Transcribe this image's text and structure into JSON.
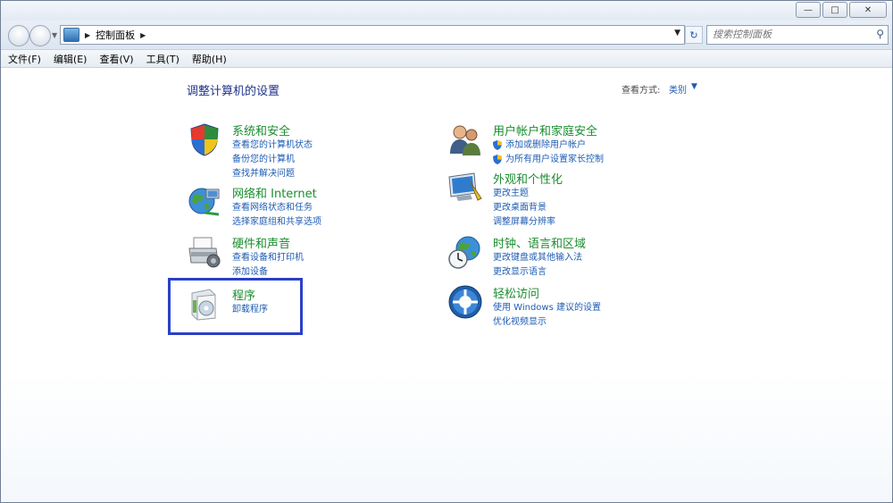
{
  "window": {
    "buttons": {
      "minimize": "—",
      "maximize": "□",
      "close": "✕"
    }
  },
  "address": {
    "crumb": "控制面板"
  },
  "search": {
    "placeholder": "搜索控制面板"
  },
  "menu": [
    "文件(F)",
    "编辑(E)",
    "查看(V)",
    "工具(T)",
    "帮助(H)"
  ],
  "page": {
    "heading": "调整计算机的设置",
    "view_by_label": "查看方式:",
    "view_by_value": "类别"
  },
  "categories": [
    {
      "title": "系统和安全",
      "links": [
        "查看您的计算机状态",
        "备份您的计算机",
        "查找并解决问题"
      ]
    },
    {
      "title": "网络和 Internet",
      "links": [
        "查看网络状态和任务",
        "选择家庭组和共享选项"
      ]
    },
    {
      "title": "硬件和声音",
      "links": [
        "查看设备和打印机",
        "添加设备"
      ]
    },
    {
      "title": "程序",
      "links": [
        "卸载程序"
      ]
    },
    {
      "title": "用户帐户和家庭安全",
      "links": [
        "添加或删除用户帐户",
        "为所有用户设置家长控制"
      ]
    },
    {
      "title": "外观和个性化",
      "links": [
        "更改主题",
        "更改桌面背景",
        "调整屏幕分辨率"
      ]
    },
    {
      "title": "时钟、语言和区域",
      "links": [
        "更改键盘或其他输入法",
        "更改显示语言"
      ]
    },
    {
      "title": "轻松访问",
      "links": [
        "使用 Windows 建议的设置",
        "优化视频显示"
      ]
    }
  ],
  "colors": {
    "category_title": "#1b8d2f",
    "link": "#1e5cb3",
    "highlight": "#2a40c8"
  }
}
